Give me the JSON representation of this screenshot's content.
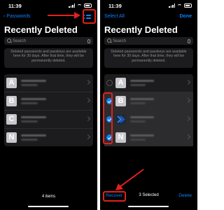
{
  "status_time": "11:39",
  "letters": [
    "A",
    "B",
    "C",
    "N"
  ],
  "left_screen": {
    "back_label": "Passwords",
    "title": "Recently Deleted",
    "search_placeholder": "Search",
    "info_text": "Deleted passwords and passkeys are available here for 30 days. After that time, they will be permanently deleted.",
    "footer_count": "4 items"
  },
  "right_screen": {
    "select_all_label": "Select All",
    "done_label": "Done",
    "title": "Recently Deleted",
    "search_placeholder": "Search",
    "info_text": "Deleted passwords and passkeys are available here for 30 days. After that time, they will be permanently deleted.",
    "recover_label": "Recover",
    "selected_count": "3 Selected",
    "delete_label": "Delete"
  },
  "colors": {
    "accent": "#0a84ff",
    "annotation_red": "#e0211d",
    "background": "#000000",
    "card": "#1c1c1e"
  }
}
